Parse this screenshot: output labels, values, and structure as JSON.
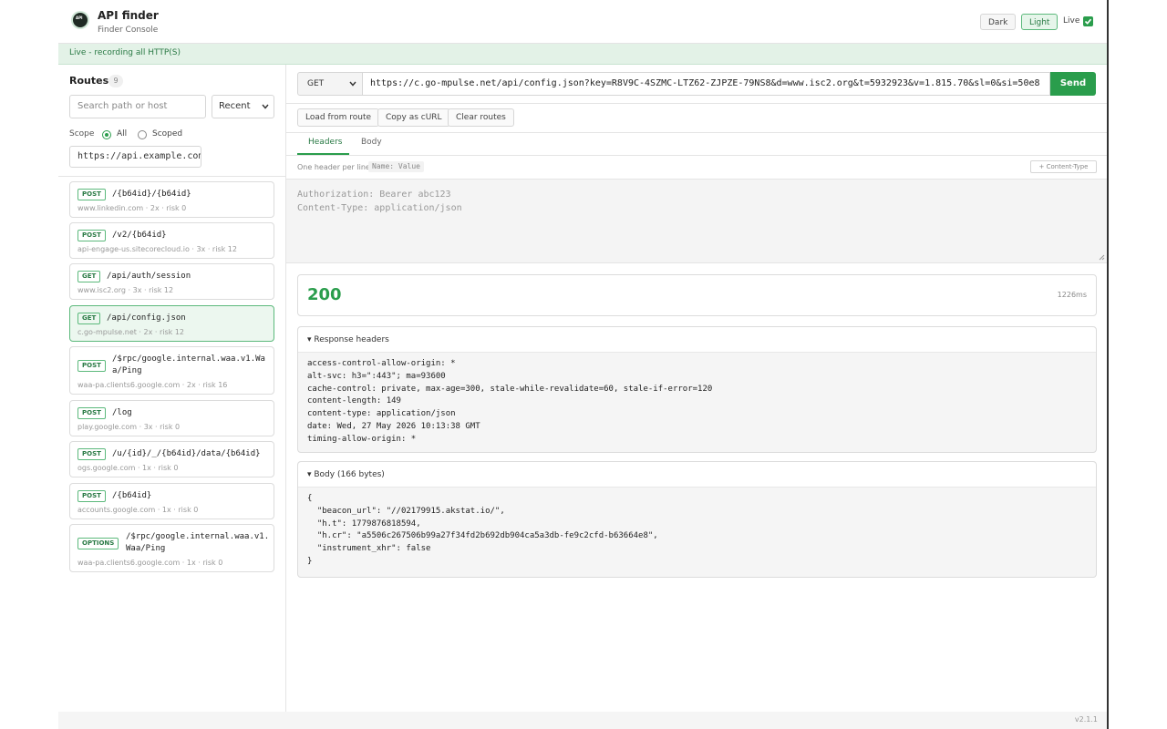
{
  "app": {
    "title": "API finder",
    "subtitle": "Finder Console",
    "logo_text": "API",
    "theme_dark": "Dark",
    "theme_light": "Light",
    "live_label": "Live",
    "live_checked": true,
    "banner": "Live - recording all HTTP(S)",
    "version": "v2.1.1"
  },
  "sidebar": {
    "title": "Routes",
    "count": "9",
    "search_placeholder": "Search path or host",
    "sort_value": "Recent",
    "scope_label": "Scope",
    "scope_all": "All",
    "scope_scoped": "Scoped",
    "scope_selected": "All",
    "host_value": "https://api.example.com",
    "routes": [
      {
        "method": "POST",
        "path": "/{b64id}/{b64id}",
        "meta": "www.linkedin.com · 2x · risk 0"
      },
      {
        "method": "POST",
        "path": "/v2/{b64id}",
        "meta": "api-engage-us.sitecorecloud.io · 3x · risk 12"
      },
      {
        "method": "GET",
        "path": "/api/auth/session",
        "meta": "www.isc2.org · 3x · risk 12"
      },
      {
        "method": "GET",
        "path": "/api/config.json",
        "meta": "c.go-mpulse.net · 2x · risk 12",
        "selected": true
      },
      {
        "method": "POST",
        "path": "/$rpc/google.internal.waa.v1.Waa/Ping",
        "meta": "waa-pa.clients6.google.com · 2x · risk 16"
      },
      {
        "method": "POST",
        "path": "/log",
        "meta": "play.google.com · 3x · risk 0"
      },
      {
        "method": "POST",
        "path": "/u/{id}/_/{b64id}/data/{b64id}",
        "meta": "ogs.google.com · 1x · risk 0"
      },
      {
        "method": "POST",
        "path": "/{b64id}",
        "meta": "accounts.google.com · 1x · risk 0"
      },
      {
        "method": "OPTIONS",
        "path": "/$rpc/google.internal.waa.v1.Waa/Ping",
        "meta": "waa-pa.clients6.google.com · 1x · risk 0"
      }
    ]
  },
  "request": {
    "method": "GET",
    "url": "https://c.go-mpulse.net/api/config.json?key=R8V9C-4SZMC-LTZ62-ZJPZE-79NS8&d=www.isc2.org&t=5932923&v=1.815.70&sl=0&si=50e8",
    "send_label": "Send",
    "actions": [
      "Load from route",
      "Copy as cURL",
      "Clear routes"
    ],
    "tabs": [
      "Headers",
      "Body"
    ],
    "active_tab": "Headers",
    "hint": "One header per line.",
    "hint_code": "Name: Value",
    "content_type_button": "+ Content-Type",
    "headers_placeholder": "Authorization: Bearer abc123\nContent-Type: application/json"
  },
  "response": {
    "status": "200",
    "time": "1226ms",
    "headers_title": "▾ Response headers",
    "headers": "access-control-allow-origin: *\nalt-svc: h3=\":443\"; ma=93600\ncache-control: private, max-age=300, stale-while-revalidate=60, stale-if-error=120\ncontent-length: 149\ncontent-type: application/json\ndate: Wed, 27 May 2026 10:13:38 GMT\ntiming-allow-origin: *",
    "body_title": "▾ Body (166 bytes)",
    "body": "{\n  \"beacon_url\": \"//02179915.akstat.io/\",\n  \"h.t\": 1779876818594,\n  \"h.cr\": \"a5506c267506b99a27f34fd2b692db904ca5a3db-fe9c2cfd-b63664e8\",\n  \"instrument_xhr\": false\n}"
  },
  "colors": {
    "accent": "#2a9d4c",
    "accent_light": "#e3f2e7"
  }
}
